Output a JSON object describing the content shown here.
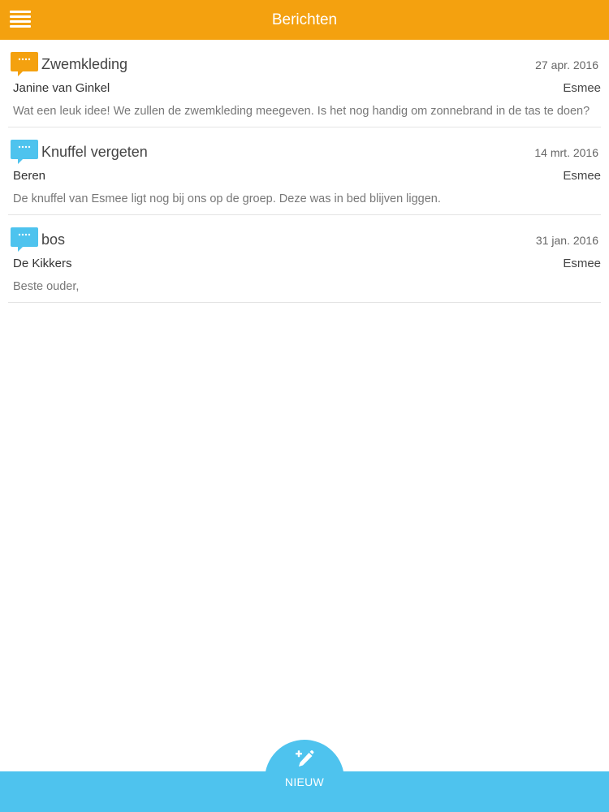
{
  "header": {
    "title": "Berichten",
    "background": "#f4a10f",
    "menu_icon": "hamburger-menu-icon"
  },
  "messages": [
    {
      "subject": "Zwemkleding",
      "date": "27 apr. 2016",
      "sender": "Janine van Ginkel",
      "child": "Esmee",
      "preview": "Wat een leuk idee! We zullen de zwemkleding meegeven. Is het nog handig om zonnebrand in de tas te doen?",
      "icon": "speech-bubble-icon",
      "icon_color": "#f4a10f"
    },
    {
      "subject": "Knuffel vergeten",
      "date": "14 mrt. 2016",
      "sender": "Beren",
      "child": "Esmee",
      "preview": "De knuffel van Esmee ligt nog bij ons op de groep. Deze was in bed blijven liggen.",
      "icon": "speech-bubble-icon",
      "icon_color": "#4ec3ee"
    },
    {
      "subject": "bos",
      "date": "31 jan. 2016",
      "sender": "De Kikkers",
      "child": "Esmee",
      "preview": "Beste ouder,",
      "icon": "speech-bubble-icon",
      "icon_color": "#4ec3ee"
    }
  ],
  "footer": {
    "new_label": "NIEUW",
    "new_icon": "compose-pencil-icon",
    "background": "#4ec3ee"
  }
}
